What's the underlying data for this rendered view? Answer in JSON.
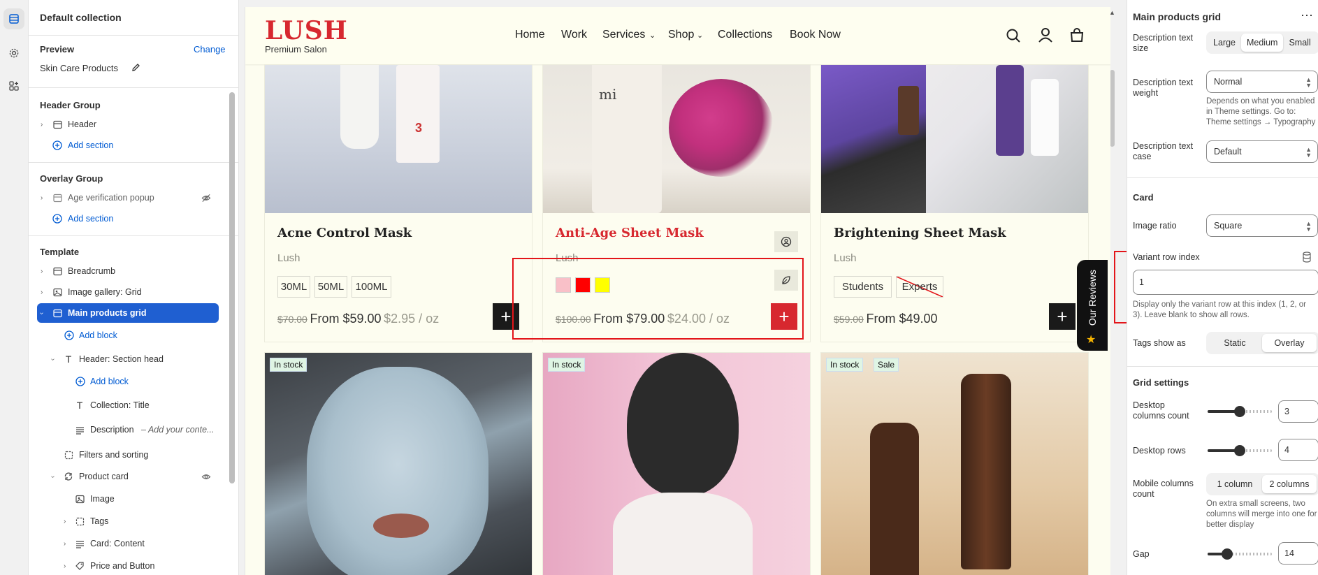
{
  "sidebar": {
    "title": "Default collection",
    "preview_label": "Preview",
    "change_link": "Change",
    "preview_value": "Skin Care Products",
    "header_group": {
      "title": "Header Group",
      "items": [
        "Header"
      ],
      "add_section": "Add section"
    },
    "overlay_group": {
      "title": "Overlay Group",
      "items": [
        "Age verification popup"
      ],
      "add_section": "Add section"
    },
    "template": {
      "title": "Template",
      "items": [
        {
          "label": "Breadcrumb"
        },
        {
          "label": "Image gallery: Grid"
        },
        {
          "label": "Main products grid",
          "selected": true
        },
        {
          "label": "Add block"
        },
        {
          "label": "Header: Section head"
        },
        {
          "label": "Add block"
        },
        {
          "label": "Collection: Title"
        },
        {
          "label": "Description",
          "suffix": "– Add your conte..."
        },
        {
          "label": "Filters and sorting"
        },
        {
          "label": "Product card"
        },
        {
          "label": "Image"
        },
        {
          "label": "Tags"
        },
        {
          "label": "Card: Content"
        },
        {
          "label": "Price and Button"
        }
      ]
    }
  },
  "store": {
    "logo": "LUSH",
    "logo_sub": "Premium Salon",
    "nav": [
      "Home",
      "Work",
      "Services",
      "Shop",
      "Collections",
      "Book Now"
    ],
    "products": [
      {
        "title": "Acne Control Mask",
        "vendor": "Lush",
        "options": [
          "30ML",
          "50ML",
          "100ML"
        ],
        "compare_price": "$70.00",
        "price": "From $59.00",
        "unit": "$2.95 / oz"
      },
      {
        "title": "Anti-Age Sheet Mask",
        "vendor": "Lush",
        "swatches": [
          "#f9c0c8",
          "#ff0000",
          "#ffff00"
        ],
        "compare_price": "$100.00",
        "price": "From $79.00",
        "unit": "$24.00 / oz"
      },
      {
        "title": "Brightening Sheet Mask",
        "vendor": "Lush",
        "options": [
          "Students",
          "Experts"
        ],
        "compare_price": "$59.00",
        "price": "From $49.00",
        "unit": ""
      }
    ],
    "row2_badges": [
      [
        "In stock"
      ],
      [
        "In stock"
      ],
      [
        "In stock",
        "Sale"
      ]
    ],
    "reviews_tab": "Our Reviews"
  },
  "panel": {
    "title": "Main products grid",
    "desc_size_label": "Description text size",
    "desc_size_options": [
      "Large",
      "Medium",
      "Small"
    ],
    "desc_size_selected": "Medium",
    "desc_weight_label": "Description text weight",
    "desc_weight_value": "Normal",
    "desc_weight_help": "Depends on what you enabled in Theme settings. Go to: Theme settings → Typography",
    "desc_case_label": "Description text case",
    "desc_case_value": "Default",
    "card_heading": "Card",
    "image_ratio_label": "Image ratio",
    "image_ratio_value": "Square",
    "variant_row_label": "Variant row index",
    "variant_row_value": "1",
    "variant_row_help": "Display only the variant row at this index (1, 2, or 3). Leave blank to show all rows.",
    "tags_label": "Tags show as",
    "tags_options": [
      "Static",
      "Overlay"
    ],
    "tags_selected": "Overlay",
    "grid_heading": "Grid settings",
    "desktop_cols_label": "Desktop columns count",
    "desktop_cols_value": "3",
    "desktop_rows_label": "Desktop rows",
    "desktop_rows_value": "4",
    "mobile_cols_label": "Mobile columns count",
    "mobile_cols_options": [
      "1 column",
      "2 columns"
    ],
    "mobile_cols_selected": "2 columns",
    "mobile_cols_help": "On extra small screens, two columns will merge into one for better display",
    "gap_label": "Gap",
    "gap_value": "14"
  },
  "colors": {
    "accent_blue": "#005bd3",
    "sale_red": "#d7282f",
    "highlight_red": "#e3151a"
  }
}
